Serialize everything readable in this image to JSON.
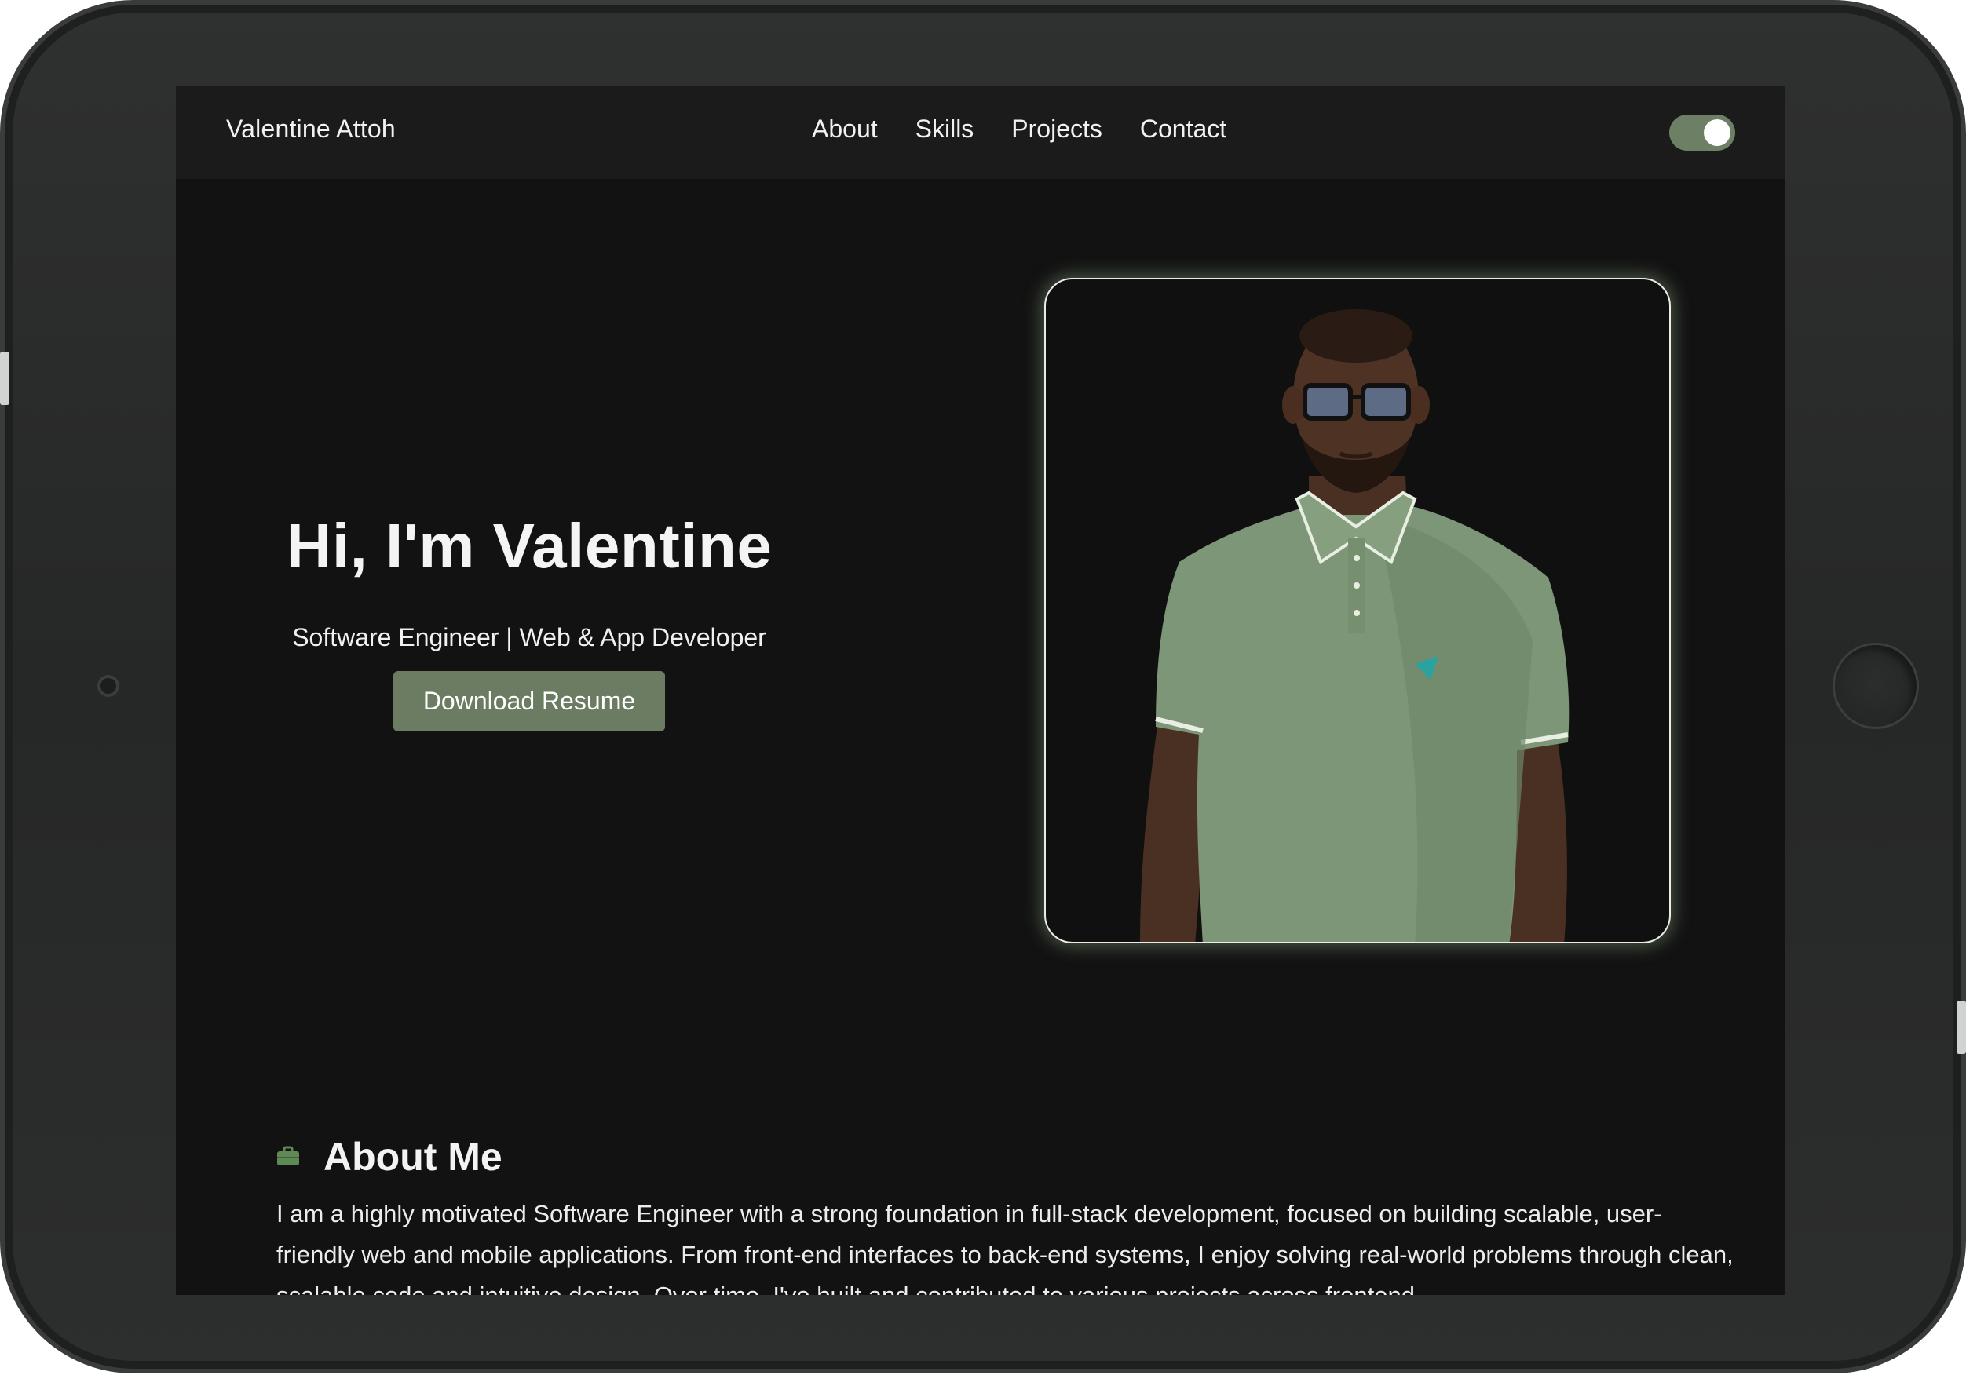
{
  "navbar": {
    "brand": "Valentine Attoh",
    "links": [
      "About",
      "Skills",
      "Projects",
      "Contact"
    ],
    "theme_toggle_on": true
  },
  "hero": {
    "title": "Hi, I'm Valentine",
    "subtitle": "Software Engineer | Web & App Developer",
    "button_label": "Download Resume",
    "photo_alt": "Portrait of Valentine in a green polo shirt"
  },
  "about": {
    "icon": "briefcase-icon",
    "heading": "About Me",
    "paragraph": "I am a highly motivated Software Engineer with a strong foundation in full-stack development, focused on building scalable, user-friendly web and mobile applications. From front-end interfaces to back-end systems, I enjoy solving real-world problems through clean, scalable code and intuitive design. Over time, I've built and contributed to various projects across frontend"
  },
  "colors": {
    "accent": "#6b7c63",
    "background": "#121212",
    "navbar": "#1b1b1b",
    "text": "#f2f2f2"
  }
}
